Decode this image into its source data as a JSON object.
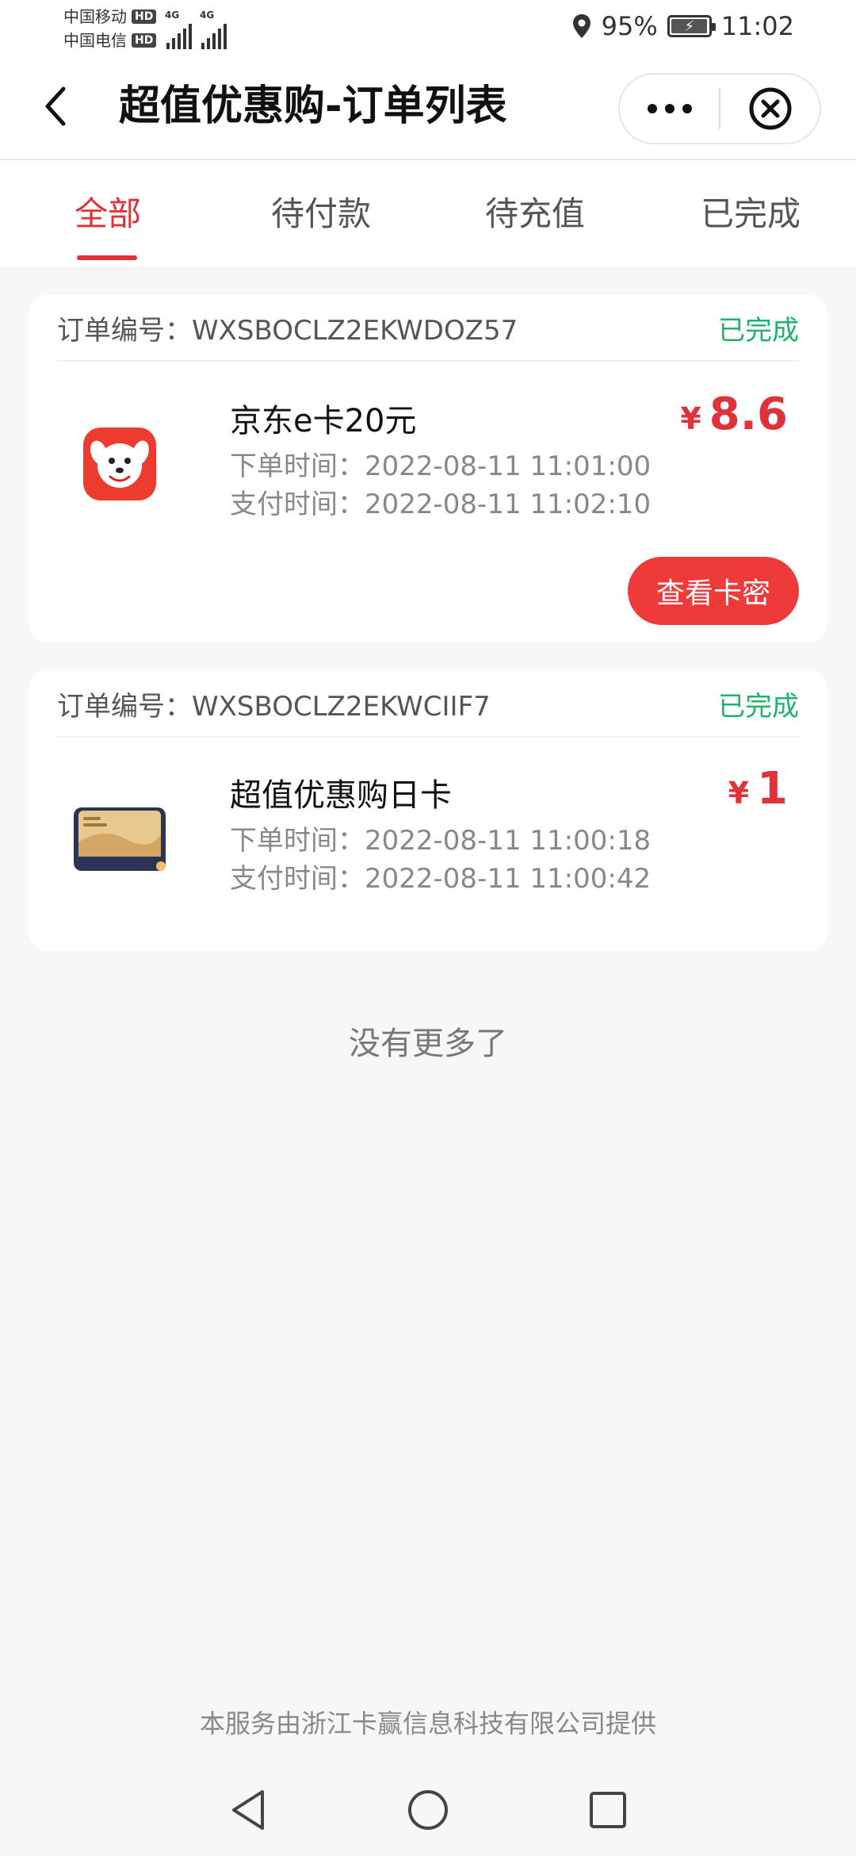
{
  "status_bar": {
    "carrier1": "中国移动",
    "carrier2": "中国电信",
    "hd": "HD",
    "network": "4G",
    "battery": "95%",
    "time": "11:02"
  },
  "title_bar": {
    "title": "超值优惠购-订单列表"
  },
  "tabs": [
    {
      "label": "全部",
      "active": true
    },
    {
      "label": "待付款",
      "active": false
    },
    {
      "label": "待充值",
      "active": false
    },
    {
      "label": "已完成",
      "active": false
    }
  ],
  "orders": [
    {
      "order_no": "订单编号：WXSBOCLZ2EKWDOZ57",
      "status": "已完成",
      "name": "京东e卡20元",
      "order_time": "下单时间：2022-08-11 11:01:00",
      "pay_time": "支付时间：2022-08-11 11:02:10",
      "currency": "¥",
      "price": "8.6",
      "action": "查看卡密",
      "icon": "jd-dog-icon"
    },
    {
      "order_no": "订单编号：WXSBOCLZ2EKWCIIF7",
      "status": "已完成",
      "name": "超值优惠购日卡",
      "order_time": "下单时间：2022-08-11 11:00:18",
      "pay_time": "支付时间：2022-08-11 11:00:42",
      "currency": "¥",
      "price": "1",
      "icon": "membership-card-icon"
    }
  ],
  "no_more": "没有更多了",
  "footer": "本服务由浙江卡赢信息科技有限公司提供",
  "colors": {
    "accent": "#e1323a",
    "button": "#ef3a3a",
    "success": "#1db36a"
  }
}
